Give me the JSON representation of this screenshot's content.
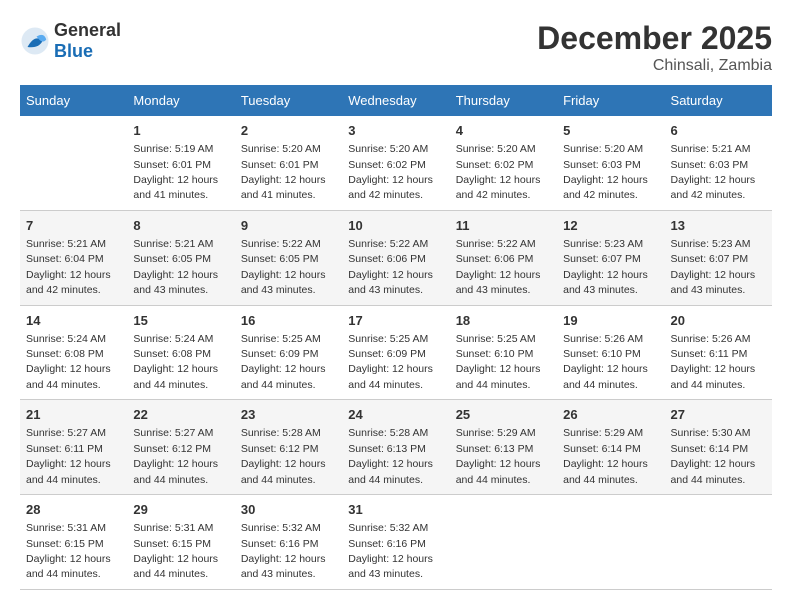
{
  "logo": {
    "general": "General",
    "blue": "Blue"
  },
  "title": "December 2025",
  "subtitle": "Chinsali, Zambia",
  "days_of_week": [
    "Sunday",
    "Monday",
    "Tuesday",
    "Wednesday",
    "Thursday",
    "Friday",
    "Saturday"
  ],
  "weeks": [
    [
      {
        "day": "",
        "info": ""
      },
      {
        "day": "1",
        "info": "Sunrise: 5:19 AM\nSunset: 6:01 PM\nDaylight: 12 hours and 41 minutes."
      },
      {
        "day": "2",
        "info": "Sunrise: 5:20 AM\nSunset: 6:01 PM\nDaylight: 12 hours and 41 minutes."
      },
      {
        "day": "3",
        "info": "Sunrise: 5:20 AM\nSunset: 6:02 PM\nDaylight: 12 hours and 42 minutes."
      },
      {
        "day": "4",
        "info": "Sunrise: 5:20 AM\nSunset: 6:02 PM\nDaylight: 12 hours and 42 minutes."
      },
      {
        "day": "5",
        "info": "Sunrise: 5:20 AM\nSunset: 6:03 PM\nDaylight: 12 hours and 42 minutes."
      },
      {
        "day": "6",
        "info": "Sunrise: 5:21 AM\nSunset: 6:03 PM\nDaylight: 12 hours and 42 minutes."
      }
    ],
    [
      {
        "day": "7",
        "info": "Sunrise: 5:21 AM\nSunset: 6:04 PM\nDaylight: 12 hours and 42 minutes."
      },
      {
        "day": "8",
        "info": "Sunrise: 5:21 AM\nSunset: 6:05 PM\nDaylight: 12 hours and 43 minutes."
      },
      {
        "day": "9",
        "info": "Sunrise: 5:22 AM\nSunset: 6:05 PM\nDaylight: 12 hours and 43 minutes."
      },
      {
        "day": "10",
        "info": "Sunrise: 5:22 AM\nSunset: 6:06 PM\nDaylight: 12 hours and 43 minutes."
      },
      {
        "day": "11",
        "info": "Sunrise: 5:22 AM\nSunset: 6:06 PM\nDaylight: 12 hours and 43 minutes."
      },
      {
        "day": "12",
        "info": "Sunrise: 5:23 AM\nSunset: 6:07 PM\nDaylight: 12 hours and 43 minutes."
      },
      {
        "day": "13",
        "info": "Sunrise: 5:23 AM\nSunset: 6:07 PM\nDaylight: 12 hours and 43 minutes."
      }
    ],
    [
      {
        "day": "14",
        "info": "Sunrise: 5:24 AM\nSunset: 6:08 PM\nDaylight: 12 hours and 44 minutes."
      },
      {
        "day": "15",
        "info": "Sunrise: 5:24 AM\nSunset: 6:08 PM\nDaylight: 12 hours and 44 minutes."
      },
      {
        "day": "16",
        "info": "Sunrise: 5:25 AM\nSunset: 6:09 PM\nDaylight: 12 hours and 44 minutes."
      },
      {
        "day": "17",
        "info": "Sunrise: 5:25 AM\nSunset: 6:09 PM\nDaylight: 12 hours and 44 minutes."
      },
      {
        "day": "18",
        "info": "Sunrise: 5:25 AM\nSunset: 6:10 PM\nDaylight: 12 hours and 44 minutes."
      },
      {
        "day": "19",
        "info": "Sunrise: 5:26 AM\nSunset: 6:10 PM\nDaylight: 12 hours and 44 minutes."
      },
      {
        "day": "20",
        "info": "Sunrise: 5:26 AM\nSunset: 6:11 PM\nDaylight: 12 hours and 44 minutes."
      }
    ],
    [
      {
        "day": "21",
        "info": "Sunrise: 5:27 AM\nSunset: 6:11 PM\nDaylight: 12 hours and 44 minutes."
      },
      {
        "day": "22",
        "info": "Sunrise: 5:27 AM\nSunset: 6:12 PM\nDaylight: 12 hours and 44 minutes."
      },
      {
        "day": "23",
        "info": "Sunrise: 5:28 AM\nSunset: 6:12 PM\nDaylight: 12 hours and 44 minutes."
      },
      {
        "day": "24",
        "info": "Sunrise: 5:28 AM\nSunset: 6:13 PM\nDaylight: 12 hours and 44 minutes."
      },
      {
        "day": "25",
        "info": "Sunrise: 5:29 AM\nSunset: 6:13 PM\nDaylight: 12 hours and 44 minutes."
      },
      {
        "day": "26",
        "info": "Sunrise: 5:29 AM\nSunset: 6:14 PM\nDaylight: 12 hours and 44 minutes."
      },
      {
        "day": "27",
        "info": "Sunrise: 5:30 AM\nSunset: 6:14 PM\nDaylight: 12 hours and 44 minutes."
      }
    ],
    [
      {
        "day": "28",
        "info": "Sunrise: 5:31 AM\nSunset: 6:15 PM\nDaylight: 12 hours and 44 minutes."
      },
      {
        "day": "29",
        "info": "Sunrise: 5:31 AM\nSunset: 6:15 PM\nDaylight: 12 hours and 44 minutes."
      },
      {
        "day": "30",
        "info": "Sunrise: 5:32 AM\nSunset: 6:16 PM\nDaylight: 12 hours and 43 minutes."
      },
      {
        "day": "31",
        "info": "Sunrise: 5:32 AM\nSunset: 6:16 PM\nDaylight: 12 hours and 43 minutes."
      },
      {
        "day": "",
        "info": ""
      },
      {
        "day": "",
        "info": ""
      },
      {
        "day": "",
        "info": ""
      }
    ]
  ]
}
